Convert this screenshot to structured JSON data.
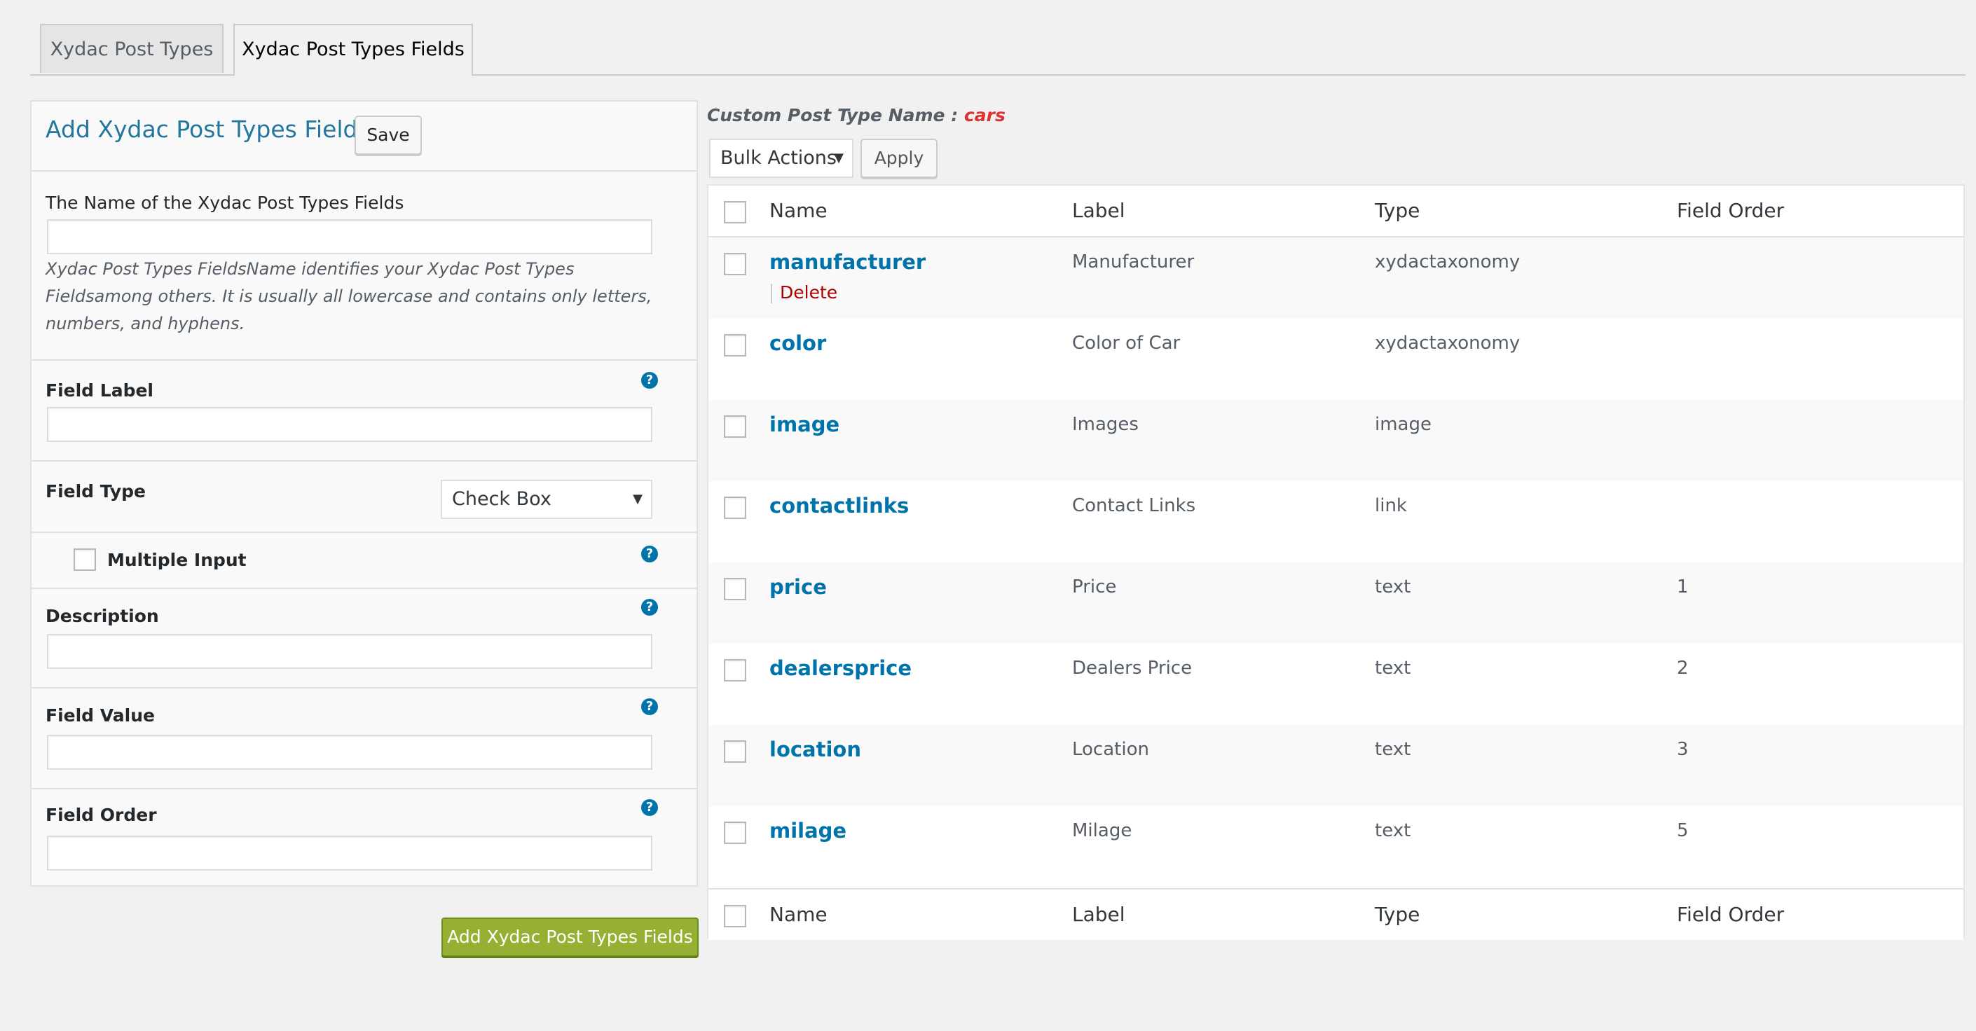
{
  "tabs": [
    {
      "label": "Xydac Post Types",
      "active": false
    },
    {
      "label": "Xydac Post Types Fields",
      "active": true
    }
  ],
  "form": {
    "title": "Add Xydac Post Types Fields",
    "save_label": "Save",
    "name_label": "The Name of the Xydac Post Types Fields",
    "name_value": "",
    "name_help": "Xydac Post Types FieldsName identifies your Xydac Post Types Fieldsamong others. It is usually all lowercase and contains only letters, numbers, and hyphens.",
    "field_label_label": "Field Label",
    "field_label_value": "",
    "field_type_label": "Field Type",
    "field_type_value": "Check Box",
    "multiple_input_label": "Multiple Input",
    "description_label": "Description",
    "description_value": "",
    "field_value_label": "Field Value",
    "field_value_value": "",
    "field_order_label": "Field Order",
    "field_order_value": "",
    "help_glyph": "?",
    "submit_label": "Add Xydac Post Types Fields"
  },
  "list": {
    "cpt_prefix": "Custom Post Type Name : ",
    "cpt_name": "cars",
    "bulk_actions_label": "Bulk Actions",
    "apply_label": "Apply",
    "dropdown_glyph": "▼",
    "columns": {
      "name": "Name",
      "label": "Label",
      "type": "Type",
      "order": "Field Order"
    },
    "delete_label": "Delete",
    "rows": [
      {
        "name": "manufacturer",
        "label": "Manufacturer",
        "type": "xydactaxonomy",
        "order": ""
      },
      {
        "name": "color",
        "label": "Color of Car",
        "type": "xydactaxonomy",
        "order": ""
      },
      {
        "name": "image",
        "label": "Images",
        "type": "image",
        "order": ""
      },
      {
        "name": "contactlinks",
        "label": "Contact Links",
        "type": "link",
        "order": ""
      },
      {
        "name": "price",
        "label": "Price",
        "type": "text",
        "order": "1"
      },
      {
        "name": "dealersprice",
        "label": "Dealers Price",
        "type": "text",
        "order": "2"
      },
      {
        "name": "location",
        "label": "Location",
        "type": "text",
        "order": "3"
      },
      {
        "name": "milage",
        "label": "Milage",
        "type": "text",
        "order": "5"
      }
    ]
  },
  "colors": {
    "link": "#0073aa",
    "title": "#23779f",
    "danger": "#dc3232",
    "primary_button": "#96b033"
  }
}
